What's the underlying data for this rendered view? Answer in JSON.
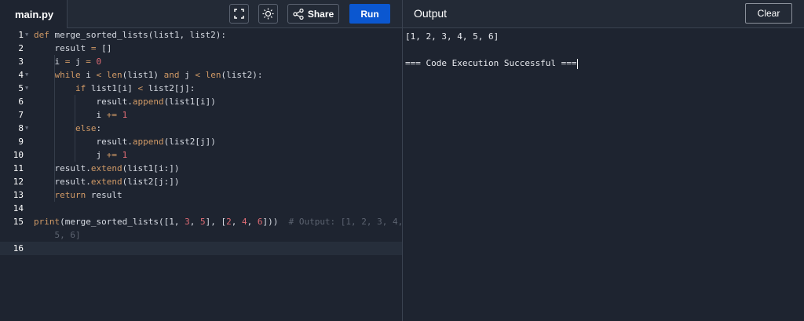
{
  "editor": {
    "file_tab": "main.py",
    "lines": [
      {
        "n": "1",
        "fold": true,
        "parts": [
          [
            "kw",
            "def "
          ],
          [
            "fn",
            "merge_sorted_lists(list1, list2):"
          ]
        ]
      },
      {
        "n": "2",
        "parts": [
          [
            "tx",
            "    result "
          ],
          [
            "op",
            "="
          ],
          [
            "tx",
            " []"
          ]
        ]
      },
      {
        "n": "3",
        "parts": [
          [
            "tx",
            "    i "
          ],
          [
            "op",
            "="
          ],
          [
            "tx",
            " j "
          ],
          [
            "op",
            "="
          ],
          [
            "tx",
            " "
          ],
          [
            "num",
            "0"
          ]
        ]
      },
      {
        "n": "4",
        "fold": true,
        "parts": [
          [
            "tx",
            "    "
          ],
          [
            "kw",
            "while"
          ],
          [
            "tx",
            " i "
          ],
          [
            "op",
            "<"
          ],
          [
            "tx",
            " "
          ],
          [
            "kw",
            "len"
          ],
          [
            "tx",
            "(list1) "
          ],
          [
            "kw",
            "and"
          ],
          [
            "tx",
            " j "
          ],
          [
            "op",
            "<"
          ],
          [
            "tx",
            " "
          ],
          [
            "kw",
            "len"
          ],
          [
            "tx",
            "(list2):"
          ]
        ]
      },
      {
        "n": "5",
        "fold": true,
        "parts": [
          [
            "tx",
            "        "
          ],
          [
            "kw",
            "if"
          ],
          [
            "tx",
            " list1[i] "
          ],
          [
            "op",
            "<"
          ],
          [
            "tx",
            " list2[j]:"
          ]
        ]
      },
      {
        "n": "6",
        "parts": [
          [
            "tx",
            "            result."
          ],
          [
            "kw",
            "append"
          ],
          [
            "tx",
            "(list1[i])"
          ]
        ]
      },
      {
        "n": "7",
        "parts": [
          [
            "tx",
            "            i "
          ],
          [
            "op",
            "+="
          ],
          [
            "tx",
            " "
          ],
          [
            "num",
            "1"
          ]
        ]
      },
      {
        "n": "8",
        "fold": true,
        "parts": [
          [
            "tx",
            "        "
          ],
          [
            "kw",
            "else"
          ],
          [
            "tx",
            ":"
          ]
        ]
      },
      {
        "n": "9",
        "parts": [
          [
            "tx",
            "            result."
          ],
          [
            "kw",
            "append"
          ],
          [
            "tx",
            "(list2[j])"
          ]
        ]
      },
      {
        "n": "10",
        "parts": [
          [
            "tx",
            "            j "
          ],
          [
            "op",
            "+="
          ],
          [
            "tx",
            " "
          ],
          [
            "num",
            "1"
          ]
        ]
      },
      {
        "n": "11",
        "parts": [
          [
            "tx",
            "    result."
          ],
          [
            "kw",
            "extend"
          ],
          [
            "tx",
            "(list1[i:])"
          ]
        ]
      },
      {
        "n": "12",
        "parts": [
          [
            "tx",
            "    result."
          ],
          [
            "kw",
            "extend"
          ],
          [
            "tx",
            "(list2[j:])"
          ]
        ]
      },
      {
        "n": "13",
        "parts": [
          [
            "tx",
            "    "
          ],
          [
            "kw",
            "return"
          ],
          [
            "tx",
            " result"
          ]
        ]
      },
      {
        "n": "14",
        "parts": []
      },
      {
        "n": "15",
        "parts": [
          [
            "kw",
            "print"
          ],
          [
            "tx",
            "(merge_sorted_lists([1, "
          ],
          [
            "num",
            "3"
          ],
          [
            "tx",
            ", "
          ],
          [
            "num",
            "5"
          ],
          [
            "tx",
            "], ["
          ],
          [
            "num",
            "2"
          ],
          [
            "tx",
            ", "
          ],
          [
            "num",
            "4"
          ],
          [
            "tx",
            ", "
          ],
          [
            "num",
            "6"
          ],
          [
            "tx",
            "]))  "
          ],
          [
            "cm",
            "# Output: [1, 2, 3, 4,"
          ]
        ]
      },
      {
        "n": "",
        "parts": [
          [
            "cm",
            "    5, 6]"
          ]
        ]
      },
      {
        "n": "16",
        "active": true,
        "parts": []
      }
    ]
  },
  "toolbar": {
    "share_label": "Share",
    "run_label": "Run",
    "fullscreen_icon": "fullscreen-icon",
    "theme_icon": "sun-icon",
    "share_icon": "share-icon"
  },
  "output": {
    "title": "Output",
    "clear_label": "Clear",
    "lines": [
      "[1, 2, 3, 4, 5, 6]",
      "",
      "=== Code Execution Successful ==="
    ]
  },
  "colors": {
    "background": "#1e2430",
    "run_button": "#0b57d0",
    "keyword": "#d19a66",
    "number": "#e06c75",
    "comment": "#5c6370"
  }
}
